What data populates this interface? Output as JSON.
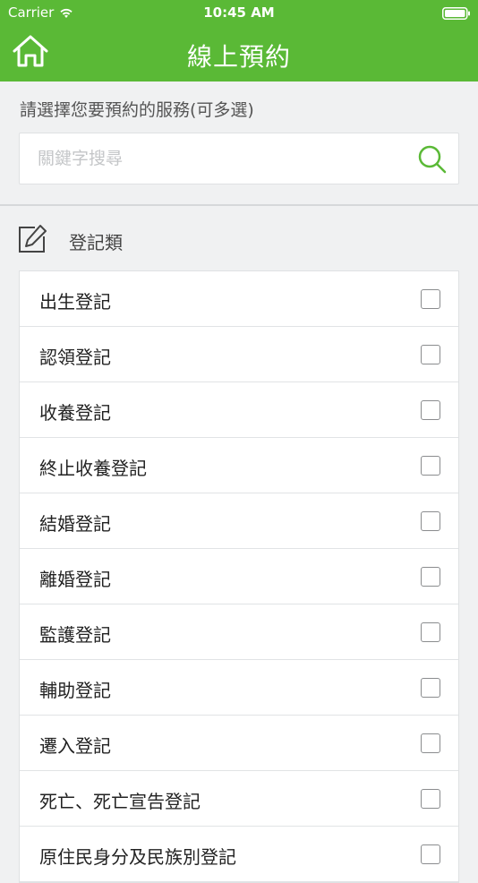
{
  "status_bar": {
    "carrier": "Carrier",
    "time": "10:45 AM"
  },
  "nav": {
    "title": "線上預約",
    "home_icon": "home-icon"
  },
  "prompt": "請選擇您要預約的服務(可多選)",
  "search": {
    "placeholder": "關鍵字搜尋",
    "value": ""
  },
  "section": {
    "title": "登記類",
    "icon": "edit-icon"
  },
  "items": [
    {
      "label": "出生登記",
      "checked": false
    },
    {
      "label": "認領登記",
      "checked": false
    },
    {
      "label": "收養登記",
      "checked": false
    },
    {
      "label": "終止收養登記",
      "checked": false
    },
    {
      "label": "結婚登記",
      "checked": false
    },
    {
      "label": "離婚登記",
      "checked": false
    },
    {
      "label": "監護登記",
      "checked": false
    },
    {
      "label": "輔助登記",
      "checked": false
    },
    {
      "label": "遷入登記",
      "checked": false
    },
    {
      "label": "死亡、死亡宣告登記",
      "checked": false
    },
    {
      "label": "原住民身分及民族別登記",
      "checked": false
    }
  ],
  "colors": {
    "brand_green": "#5ab936",
    "background": "#f0f1f2"
  }
}
